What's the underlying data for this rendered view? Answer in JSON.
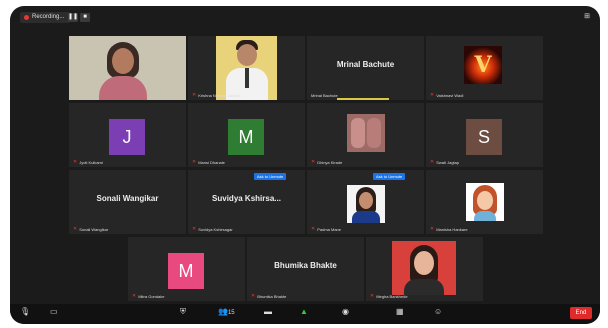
{
  "topbar": {
    "recording_label": "Recording...",
    "pause_icon": "pause-icon",
    "stop_icon": "stop-icon",
    "view_icon": "grid-view-icon"
  },
  "tiles": [
    {
      "id": "t1",
      "name": "",
      "kind": "video-woman",
      "speaking": true
    },
    {
      "id": "t2",
      "name": "Krishna Nandan Jadhav",
      "kind": "video-man"
    },
    {
      "id": "t3",
      "name": "Mrinal Bachute",
      "big_name": "Mrinal Bachute",
      "kind": "name"
    },
    {
      "id": "t4",
      "name": "Vaishnavi Wadi",
      "kind": "avatar-v"
    },
    {
      "id": "t5",
      "name": "Jyoti Kulkarni",
      "initial": "J",
      "color": "#7b3fb3",
      "kind": "initial"
    },
    {
      "id": "t6",
      "name": "Mansi Dhanale",
      "initial": "M",
      "color": "#2e7d32",
      "kind": "initial"
    },
    {
      "id": "t7",
      "name": "Dhinya Kirade",
      "kind": "avatar-photo"
    },
    {
      "id": "t8",
      "name": "Swati Jagtap",
      "initial": "S",
      "color": "#6d4c41",
      "kind": "initial"
    },
    {
      "id": "t9",
      "name": "Sonali Wangikar",
      "big_name": "Sonali Wangikar",
      "kind": "name"
    },
    {
      "id": "t10",
      "name": "Suvidya Kshirsagar",
      "big_name": "Suvidya Kshirsa...",
      "chip": "Ask to Unmute",
      "kind": "name"
    },
    {
      "id": "t11",
      "name": "Padma Mane",
      "chip": "Ask to Unmute",
      "kind": "avatar-woman"
    },
    {
      "id": "t12",
      "name": "Manisha Hankare",
      "kind": "avatar-cartoon"
    },
    {
      "id": "t13",
      "name": "Mitra Gondake",
      "initial": "M",
      "color": "#e84a7f",
      "kind": "initial"
    },
    {
      "id": "t14",
      "name": "Bhumika Bhakte",
      "big_name": "Bhumika Bhakte",
      "kind": "name"
    },
    {
      "id": "t15",
      "name": "Megha Bankhede",
      "kind": "avatar-redwoman"
    }
  ],
  "toolbar": {
    "icons": [
      "mic-muted-icon",
      "video-icon",
      "security-icon",
      "participants-icon",
      "chat-icon",
      "share-screen-icon",
      "record-icon",
      "breakout-rooms-icon",
      "reactions-icon"
    ],
    "participants_count": "15",
    "end_label": "End"
  }
}
